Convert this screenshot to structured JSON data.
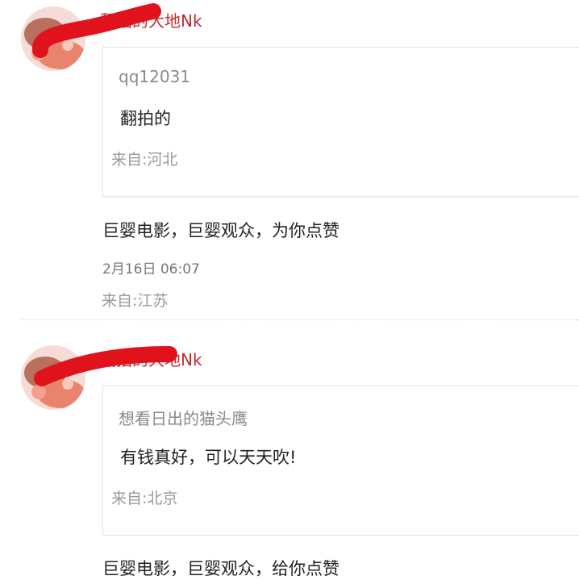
{
  "comments": [
    {
      "username": "翻拍的大地Nk",
      "quoted": {
        "user": "qq12031",
        "text": "翻拍的",
        "location": "来自:河北"
      },
      "reply_text": "巨婴电影，巨婴观众，为你点赞",
      "timestamp": "2月16日 06:07",
      "location": "来自:江苏"
    },
    {
      "username": "翻拍的大地Nk",
      "quoted": {
        "user": "想看日出的猫头鹰",
        "text": "有钱真好，可以天天吹!",
        "location": "来自:北京"
      },
      "reply_text": "巨婴电影，巨婴观众，给你点赞"
    }
  ],
  "colors": {
    "username": "#c0282e",
    "redaction": "#e0121b",
    "meta_text": "#9a9a9a",
    "body_text": "#222222"
  },
  "icons": {
    "avatar": "avatar-illustration",
    "redaction": "red-scribble-mark"
  }
}
